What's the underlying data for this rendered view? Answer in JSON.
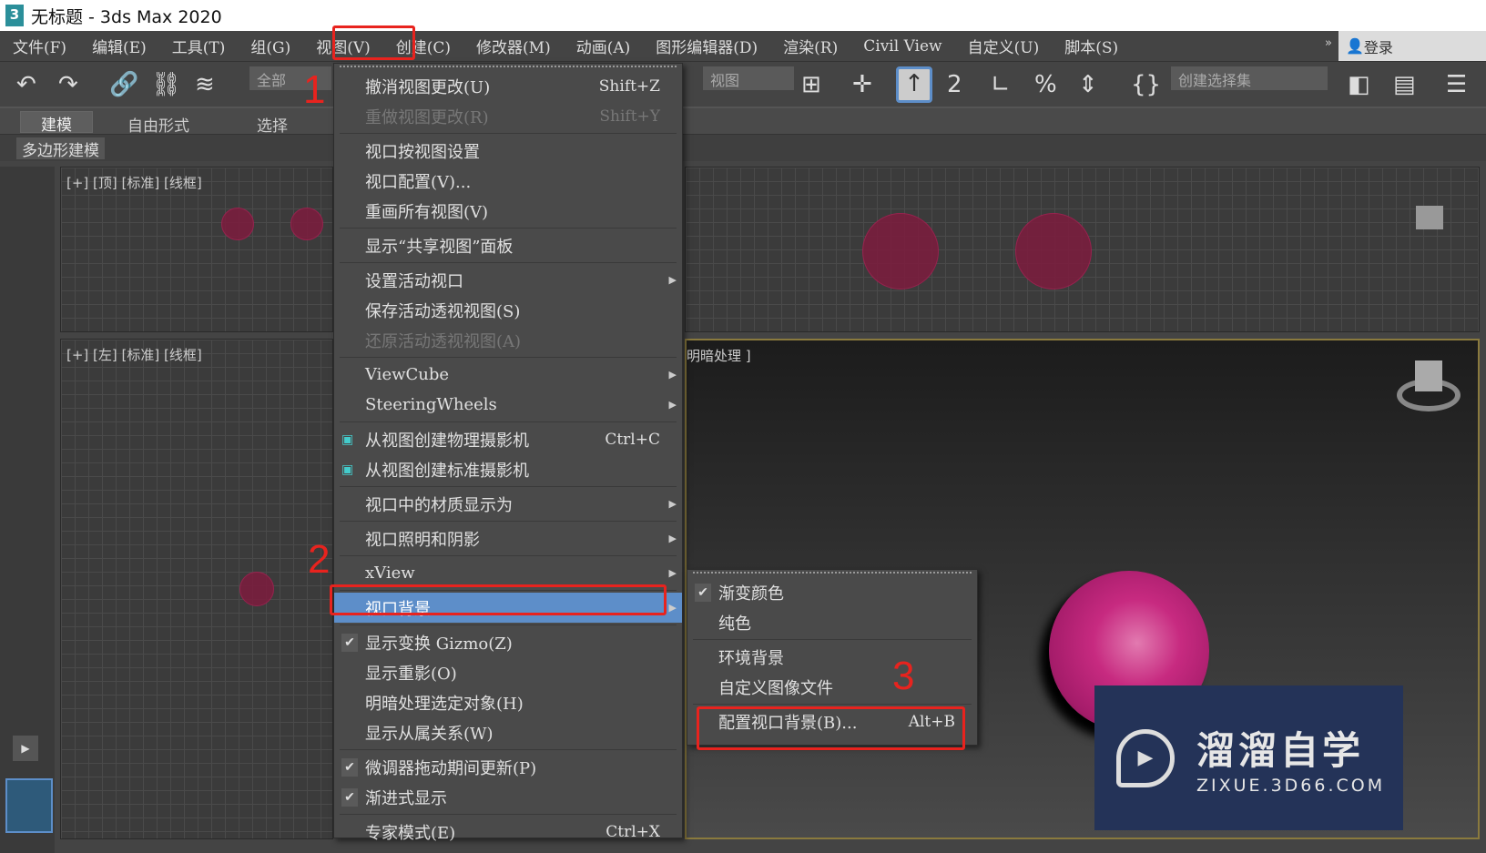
{
  "window": {
    "title": "无标题 - 3ds Max 2020",
    "app_icon": "3"
  },
  "menubar": [
    "文件(F)",
    "编辑(E)",
    "工具(T)",
    "组(G)",
    "视图(V)",
    "创建(C)",
    "修改器(M)",
    "动画(A)",
    "图形编辑器(D)",
    "渲染(R)",
    "Civil View",
    "自定义(U)",
    "脚本(S)"
  ],
  "login": "登录",
  "more": "»",
  "toolbar": {
    "filter": "全部",
    "ref_coord": "视图",
    "selection_set": "创建选择集"
  },
  "ribbon": {
    "tabs": [
      "建模",
      "自由形式",
      "选择"
    ],
    "sub": "多边形建模"
  },
  "viewports": {
    "top": "[+] [顶] [标准] [线框]",
    "left": "[+] [左] [标准] [线框]",
    "persp_partial": "明暗处理 ]"
  },
  "view_menu": [
    {
      "label": "撤消视图更改(U)",
      "shortcut": "Shift+Z"
    },
    {
      "label": "重做视图更改(R)",
      "shortcut": "Shift+Y",
      "disabled": true,
      "sep": true
    },
    {
      "label": "视口按视图设置"
    },
    {
      "label": "视口配置(V)..."
    },
    {
      "label": "重画所有视图(V)",
      "sep": true
    },
    {
      "label": "显示“共享视图”面板",
      "sep": true
    },
    {
      "label": "设置活动视口",
      "submenu": true
    },
    {
      "label": "保存活动透视视图(S)"
    },
    {
      "label": "还原活动透视视图(A)",
      "disabled": true,
      "sep": true
    },
    {
      "label": "ViewCube",
      "submenu": true
    },
    {
      "label": "SteeringWheels",
      "submenu": true,
      "sep": true
    },
    {
      "label": "从视图创建物理摄影机",
      "shortcut": "Ctrl+C",
      "icon": "camera"
    },
    {
      "label": "从视图创建标准摄影机",
      "icon": "camera",
      "sep": true
    },
    {
      "label": "视口中的材质显示为",
      "submenu": true,
      "sep": true
    },
    {
      "label": "视口照明和阴影",
      "submenu": true,
      "sep": true
    },
    {
      "label": "xView",
      "submenu": true,
      "sep": true
    },
    {
      "label": "视口背景",
      "submenu": true,
      "highlighted": true,
      "sep": true
    },
    {
      "label": "显示变换 Gizmo(Z)",
      "checked": true
    },
    {
      "label": "显示重影(O)"
    },
    {
      "label": "明暗处理选定对象(H)"
    },
    {
      "label": "显示从属关系(W)",
      "sep": true
    },
    {
      "label": "微调器拖动期间更新(P)",
      "checked": true
    },
    {
      "label": "渐进式显示",
      "checked": true,
      "sep": true
    },
    {
      "label": "专家模式(E)",
      "shortcut": "Ctrl+X"
    }
  ],
  "background_submenu": [
    {
      "label": "渐变颜色",
      "checked": true
    },
    {
      "label": "纯色",
      "sep": true
    },
    {
      "label": "环境背景"
    },
    {
      "label": "自定义图像文件",
      "sep": true
    },
    {
      "label": "配置视口背景(B)...",
      "shortcut": "Alt+B"
    }
  ],
  "annotations": [
    "1",
    "2",
    "3"
  ],
  "watermark": {
    "cn": "溜溜自学",
    "en": "ZIXUE.3D66.COM"
  },
  "colors": {
    "highlight": "#5d8ec9",
    "annotation": "#e8231e",
    "sphere": "#c72a80"
  }
}
